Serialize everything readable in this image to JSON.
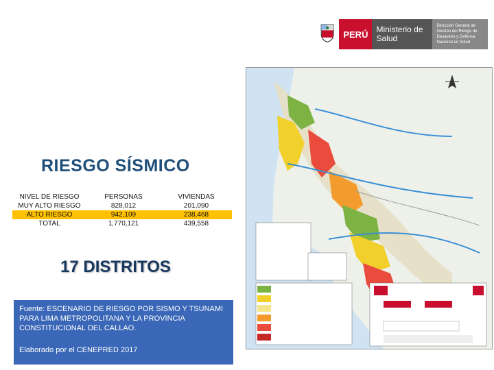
{
  "header": {
    "peru": "PERÚ",
    "ministerio": "Ministerio de Salud",
    "direccion": "Dirección General de Gestión del Riesgo de Desastres y Defensa Nacional en Salud"
  },
  "slide": {
    "title": "RIESGO SÍSMICO",
    "table": {
      "headers": [
        "NIVEL DE RIESGO",
        "PERSONAS",
        "VIVIENDAS"
      ],
      "rows": [
        {
          "nivel": "MUY ALTO RIESGO",
          "personas": "828,012",
          "viviendas": "201,090"
        },
        {
          "nivel": "ALTO RIESGO",
          "personas": "942,109",
          "viviendas": "238,468"
        },
        {
          "nivel": "TOTAL",
          "personas": "1,770,121",
          "viviendas": "439,558"
        }
      ]
    },
    "distritos": "17 DISTRITOS",
    "fuente": "Fuente: ESCENARIO DE RIESGO POR SISMO Y TSUNAMI PARA LIMA METROPOLITANA Y LA PROVINCIA CONSTITUCIONAL DEL CALLAO.",
    "elaborado": "Elaborado por el CENEPRED 2017"
  },
  "colors": {
    "title": "#1f4e79",
    "peru_red": "#c8102e",
    "fuente_bg": "#3a67b7",
    "alto_row": "#ffc000"
  }
}
